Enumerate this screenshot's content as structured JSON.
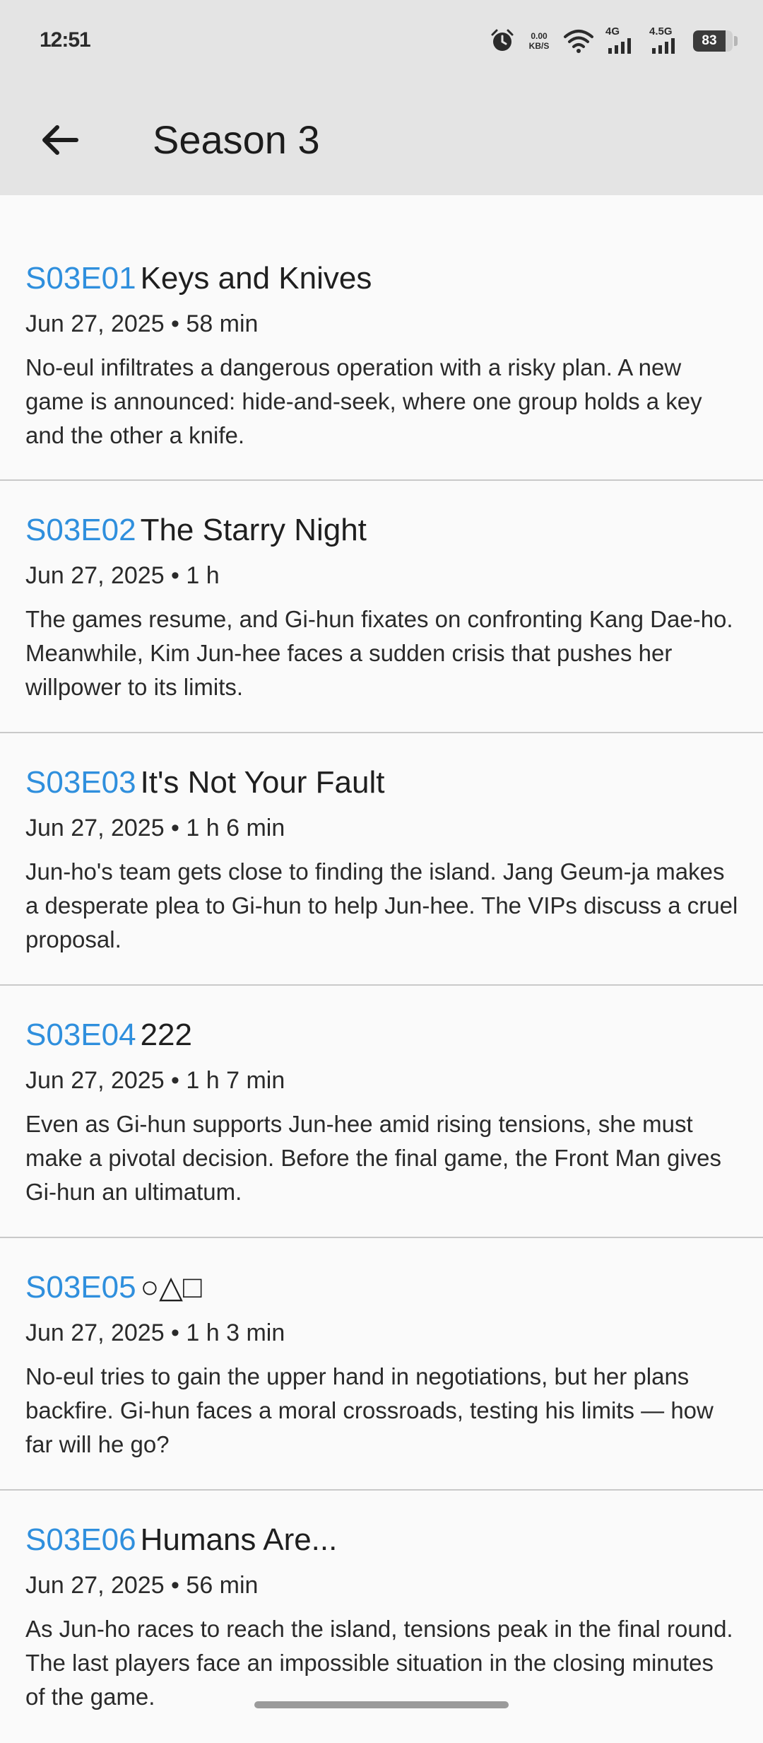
{
  "status_bar": {
    "time": "12:51",
    "net_speed_value": "0.00",
    "net_speed_unit": "KB/S",
    "sim1_label": "4G",
    "sim2_label": "4.5G",
    "battery_level": "83",
    "icons": [
      "alarm-icon",
      "wifi-icon",
      "signal-icon",
      "signal-icon",
      "battery-icon"
    ]
  },
  "app_bar": {
    "back_icon": "arrow-back-icon",
    "title": "Season 3"
  },
  "episodes": [
    {
      "code": "S03E01",
      "title": "Keys and Knives",
      "meta": "Jun 27, 2025 • 58 min",
      "description": "No-eul infiltrates a dangerous operation with a risky plan. A new game is announced: hide-and-seek, where one group holds a key and the other a knife."
    },
    {
      "code": "S03E02",
      "title": "The Starry Night",
      "meta": "Jun 27, 2025 • 1 h",
      "description": "The games resume, and Gi-hun fixates on confronting Kang Dae-ho. Meanwhile, Kim Jun-hee faces a sudden crisis that pushes her willpower to its limits."
    },
    {
      "code": "S03E03",
      "title": "It's Not Your Fault",
      "meta": "Jun 27, 2025 • 1 h 6 min",
      "description": "Jun-ho's team gets close to finding the island. Jang Geum-ja makes a desperate plea to Gi-hun to help Jun-hee. The VIPs discuss a cruel proposal."
    },
    {
      "code": "S03E04",
      "title": "222",
      "meta": "Jun 27, 2025 • 1 h 7 min",
      "description": "Even as Gi-hun supports Jun-hee amid rising tensions, she must make a pivotal decision. Before the final game, the Front Man gives Gi-hun an ultimatum."
    },
    {
      "code": "S03E05",
      "title": "○△□",
      "meta": "Jun 27, 2025 • 1 h 3 min",
      "description": "No-eul tries to gain the upper hand in negotiations, but her plans backfire. Gi-hun faces a moral crossroads, testing his limits — how far will he go?"
    },
    {
      "code": "S03E06",
      "title": "Humans Are...",
      "meta": "Jun 27, 2025 • 56 min",
      "description": "As Jun-ho races to reach the island, tensions peak in the final round. The last players face an impossible situation in the closing minutes of the game."
    }
  ],
  "colors": {
    "accent": "#2f8fdd",
    "app_bar_bg": "#e4e4e4",
    "page_bg": "#fafafa",
    "divider": "#c9c9c9"
  }
}
